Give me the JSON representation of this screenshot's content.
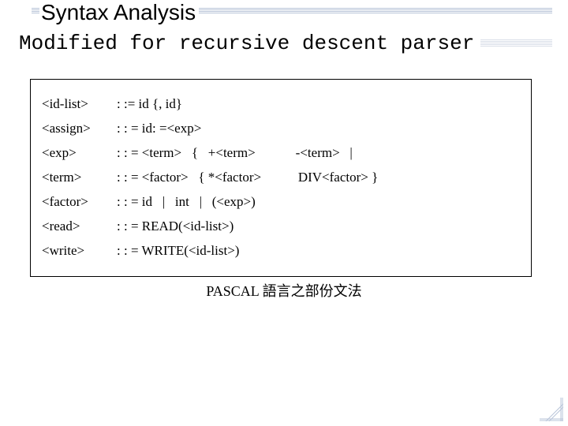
{
  "title": "Syntax Analysis",
  "subtitle": "Modified for recursive descent parser",
  "grammar": [
    {
      "lhs": "<id-list>",
      "rhs": ": := id {, id}"
    },
    {
      "lhs": "<assign>",
      "rhs": ": : = id: =<exp>"
    },
    {
      "lhs": "<exp>",
      "rhs": ": : = <term>   {   +<term>            -<term>   |"
    },
    {
      "lhs": "<term>",
      "rhs": ": : = <factor>   { *<factor>           DIV<factor> }"
    },
    {
      "lhs": "<factor>",
      "rhs": ": : = id   |   int   |   (<exp>)"
    },
    {
      "lhs": "<read>",
      "rhs": ": : = READ(<id-list>)"
    },
    {
      "lhs": "<write>",
      "rhs": ": : = WRITE(<id-list>)"
    }
  ],
  "caption": "PASCAL 語言之部份文法"
}
